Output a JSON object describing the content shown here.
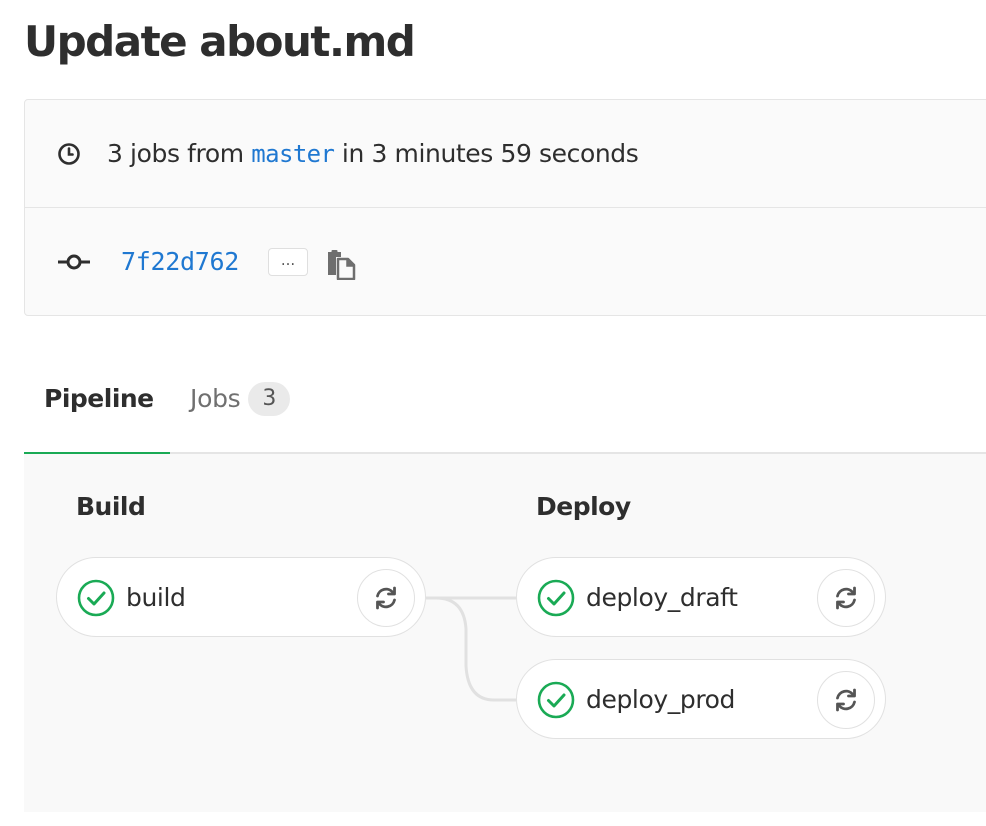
{
  "page": {
    "title": "Update about.md"
  },
  "summary": {
    "prefix": "3 jobs from ",
    "branch": "master",
    "suffix": " in 3 minutes 59 seconds",
    "clock_icon": "clock-icon"
  },
  "commit": {
    "sha": "7f22d762",
    "expand_label": "...",
    "commit_icon": "commit-icon",
    "copy_icon": "clipboard-icon"
  },
  "tabs": [
    {
      "label": "Pipeline",
      "active": true
    },
    {
      "label": "Jobs",
      "count": "3",
      "active": false
    }
  ],
  "stages": [
    {
      "title": "Build",
      "jobs": [
        {
          "name": "build",
          "status": "success"
        }
      ]
    },
    {
      "title": "Deploy",
      "jobs": [
        {
          "name": "deploy_draft",
          "status": "success"
        },
        {
          "name": "deploy_prod",
          "status": "success"
        }
      ]
    }
  ],
  "colors": {
    "success": "#1aaa55",
    "link": "#1f78d1",
    "active_tab": "#1aaa55"
  }
}
